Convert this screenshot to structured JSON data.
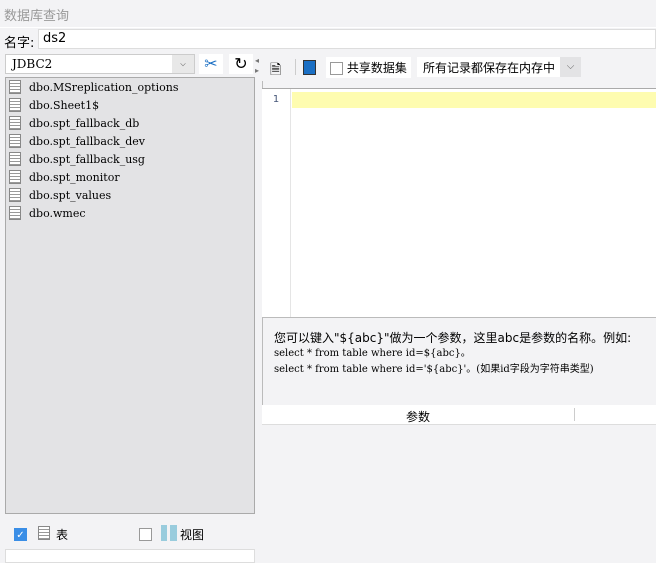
{
  "window": {
    "title": "数据库查询"
  },
  "name_field": {
    "label": "名字:",
    "value": "ds2"
  },
  "connection": {
    "selected": "JDBC2"
  },
  "tables": [
    "dbo.MSreplication_options",
    "dbo.Sheet1$",
    "dbo.spt_fallback_db",
    "dbo.spt_fallback_dev",
    "dbo.spt_fallback_usg",
    "dbo.spt_monitor",
    "dbo.spt_values",
    "dbo.wmec"
  ],
  "filters": {
    "tables_label": "表",
    "tables_checked": true,
    "views_label": "视图",
    "views_checked": false
  },
  "toolbar": {
    "share_label": "共享数据集",
    "share_checked": false,
    "storage_option": "所有记录都保存在内存中"
  },
  "editor": {
    "line_number": "1"
  },
  "hint": {
    "line1": "您可以键入\"${abc}\"做为一个参数，这里abc是参数的名称。例如:",
    "line2": "select * from table where id=${abc}。",
    "line3": "select * from table where id='${abc}'。(如果id字段为字符串类型)"
  },
  "params": {
    "header": "参数"
  }
}
